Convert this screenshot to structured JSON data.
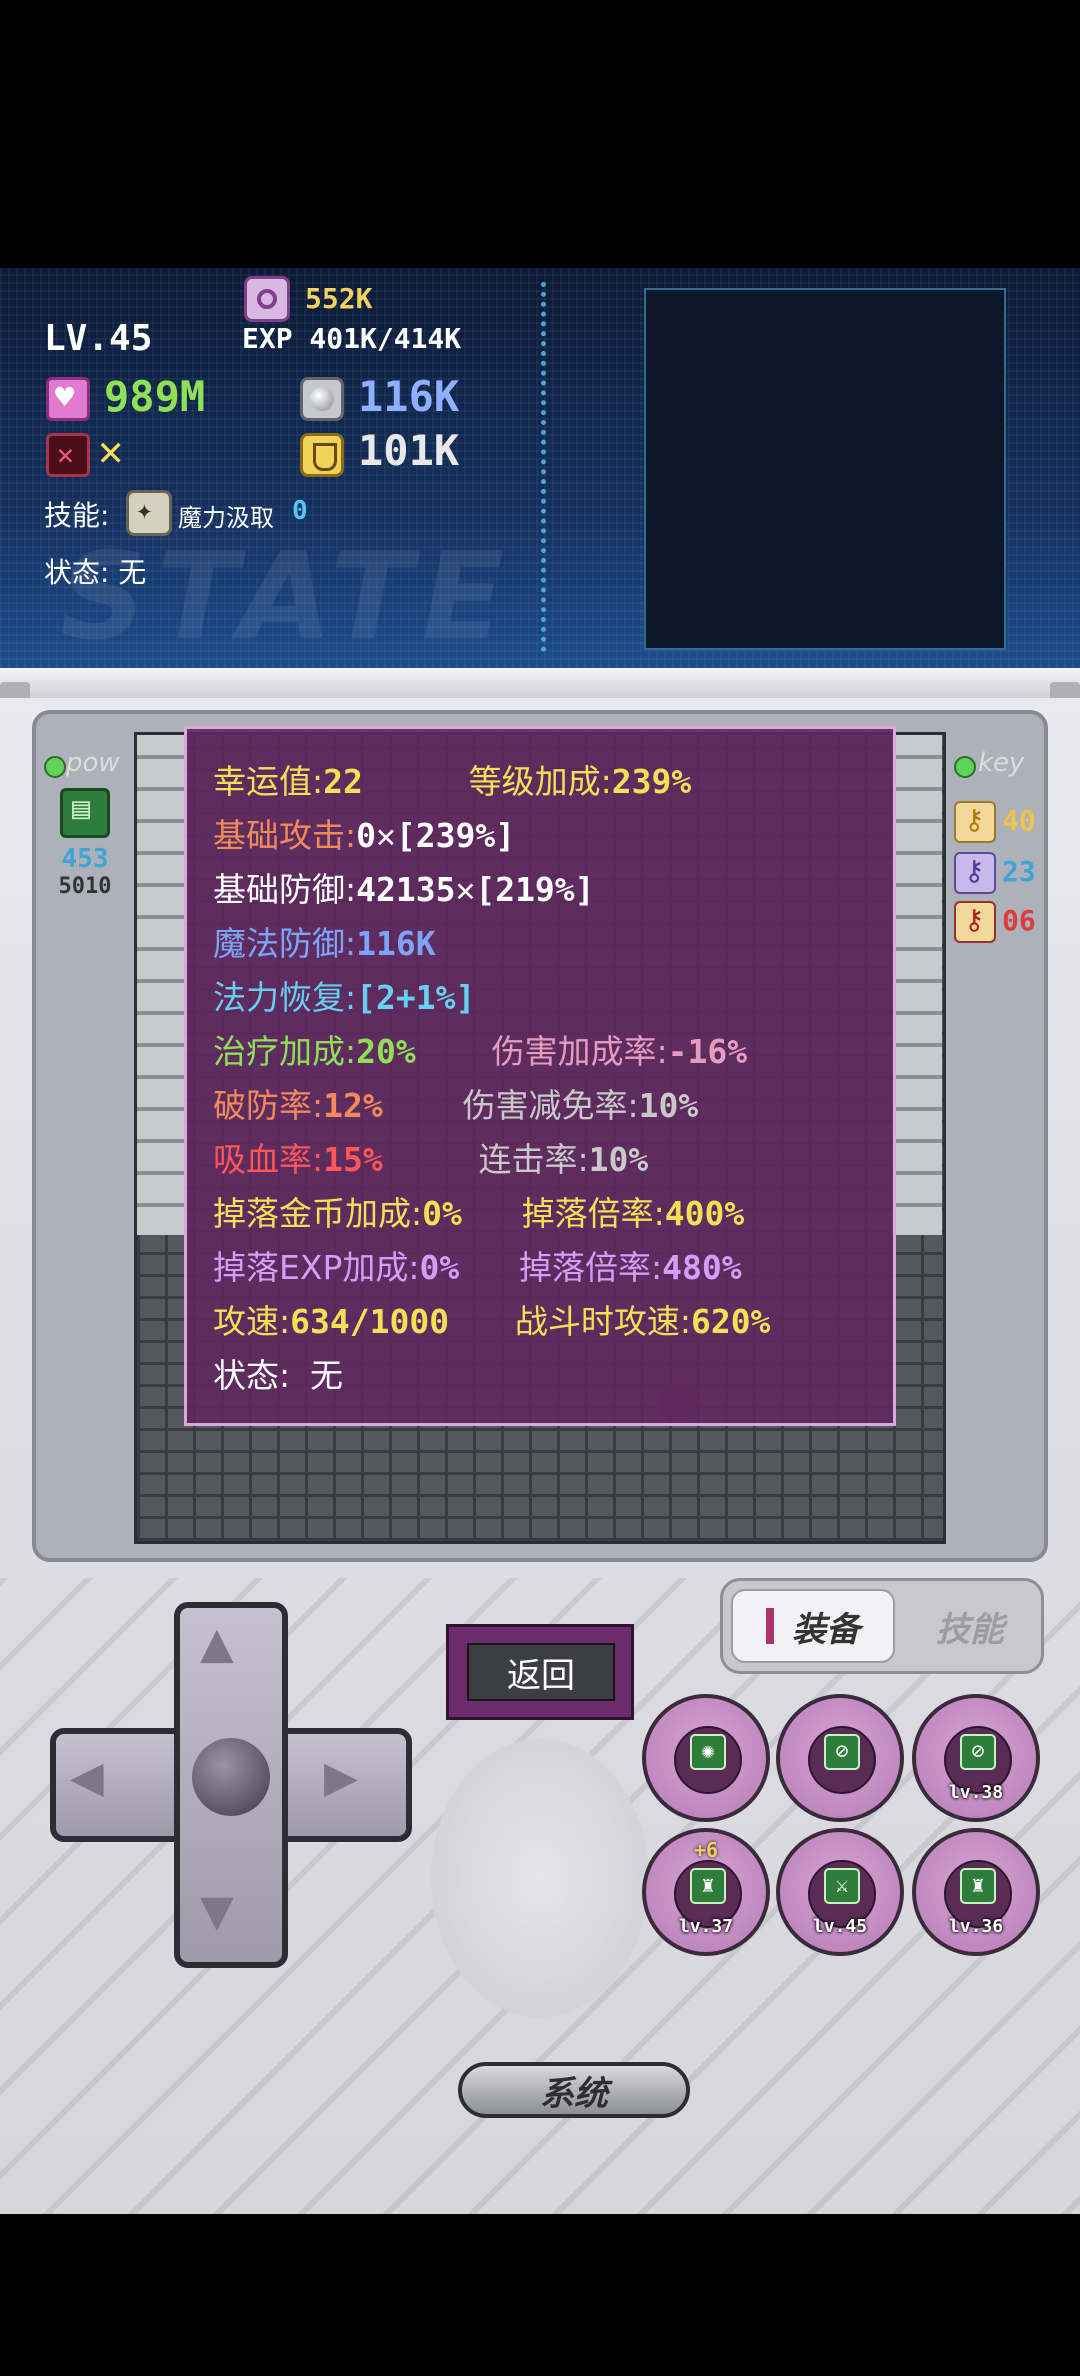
{
  "top": {
    "level": "LV.45",
    "gold": "552K",
    "exp": "EXP 401K/414K",
    "hp": "989M",
    "attack": "✕",
    "magic_def": "116K",
    "defense": "101K",
    "skill_label": "技能:",
    "skill_name": "魔力汲取",
    "skill_level": "0",
    "status_label": "状态:",
    "status_value": "无",
    "watermark": "STATE"
  },
  "side_left": {
    "label": "pow",
    "value": "453",
    "sub": "5010"
  },
  "side_right": {
    "label": "key",
    "yellow": "40",
    "blue": "23",
    "red": "06"
  },
  "attributes": {
    "luck_k": "幸运值:",
    "luck_v": "22",
    "lvbonus_k": "等级加成:",
    "lvbonus_v": "239%",
    "base_atk_k": "基础攻击:",
    "base_atk_v": "0✕[239%]",
    "base_def_k": "基础防御:",
    "base_def_v": "42135✕[219%]",
    "mdef_k": "魔法防御:",
    "mdef_v": "116K",
    "mana_k": "法力恢复:",
    "mana_v": "[2+1%]",
    "heal_k": "治疗加成:",
    "heal_v": "20%",
    "dmgbonus_k": "伤害加成率:",
    "dmgbonus_v": "-16%",
    "pierce_k": "破防率:",
    "pierce_v": "12%",
    "dmgreduce_k": "伤害减免率:",
    "dmgreduce_v": "10%",
    "lifesteal_k": "吸血率:",
    "lifesteal_v": "15%",
    "combo_k": "连击率:",
    "combo_v": "10%",
    "goldbonus_k": "掉落金币加成:",
    "goldbonus_v": "0%",
    "golddrop_k": "掉落倍率:",
    "golddrop_v": "400%",
    "expbonus_k": "掉落EXP加成:",
    "expbonus_v": "0%",
    "expdrop_k": "掉落倍率:",
    "expdrop_v": "480%",
    "speed_k": "攻速:",
    "speed_v": "634/1000",
    "battlespeed_k": "战斗时攻速:",
    "battlespeed_v": "620%",
    "status_k": "状态:",
    "status_v": "无"
  },
  "controls": {
    "back": "返回",
    "tab_equip": "装备",
    "tab_skill": "技能",
    "system": "系统",
    "equips": [
      {
        "icon": "orb-icon",
        "lv": "",
        "plus": ""
      },
      {
        "icon": "sling-icon",
        "lv": "",
        "plus": ""
      },
      {
        "icon": "sling-icon",
        "lv": "lv.38",
        "plus": ""
      },
      {
        "icon": "boots-icon",
        "lv": "lv.37",
        "plus": "+6"
      },
      {
        "icon": "sword-icon",
        "lv": "lv.45",
        "plus": ""
      },
      {
        "icon": "boots-icon",
        "lv": "lv.36",
        "plus": ""
      }
    ]
  },
  "colors": {
    "popup_bg": "#602860",
    "gold": "#f2d35a",
    "hp_green": "#8fe057",
    "mdef_blue": "#8fb0ff"
  }
}
